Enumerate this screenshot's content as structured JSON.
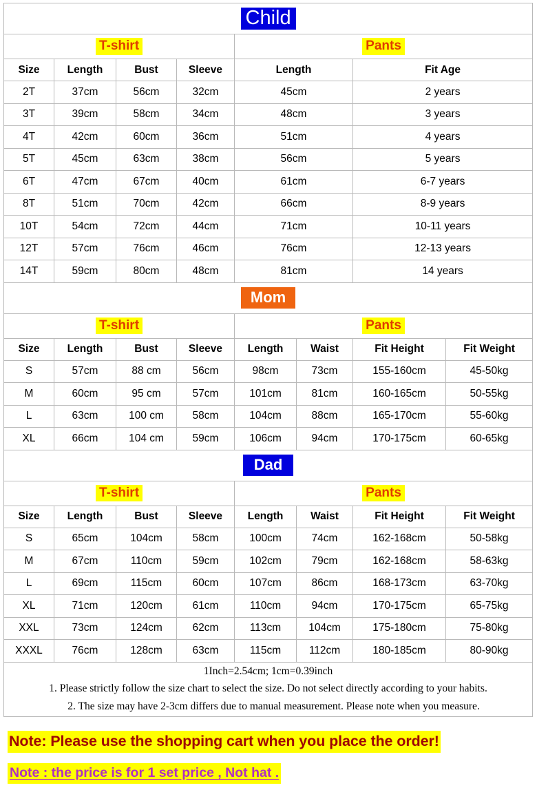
{
  "sections": [
    {
      "id": "child",
      "title": "Child",
      "title_bg": "#0000dd",
      "title_color": "#ffffff",
      "garments": {
        "tshirt": "T-shirt",
        "pants": "Pants"
      },
      "headers": [
        "Size",
        "Length",
        "Bust",
        "Sleeve",
        "Length",
        "Fit Age"
      ],
      "rows": [
        [
          "2T",
          "37cm",
          "56cm",
          "32cm",
          "45cm",
          "2 years"
        ],
        [
          "3T",
          "39cm",
          "58cm",
          "34cm",
          "48cm",
          "3 years"
        ],
        [
          "4T",
          "42cm",
          "60cm",
          "36cm",
          "51cm",
          "4 years"
        ],
        [
          "5T",
          "45cm",
          "63cm",
          "38cm",
          "56cm",
          "5 years"
        ],
        [
          "6T",
          "47cm",
          "67cm",
          "40cm",
          "61cm",
          "6-7 years"
        ],
        [
          "8T",
          "51cm",
          "70cm",
          "42cm",
          "66cm",
          "8-9 years"
        ],
        [
          "10T",
          "54cm",
          "72cm",
          "44cm",
          "71cm",
          "10-11 years"
        ],
        [
          "12T",
          "57cm",
          "76cm",
          "46cm",
          "76cm",
          "12-13 years"
        ],
        [
          "14T",
          "59cm",
          "80cm",
          "48cm",
          "81cm",
          "14 years"
        ]
      ]
    },
    {
      "id": "mom",
      "title": "Mom",
      "title_bg": "#ef6410",
      "title_color": "#ffffff",
      "garments": {
        "tshirt": "T-shirt",
        "pants": "Pants"
      },
      "headers": [
        "Size",
        "Length",
        "Bust",
        "Sleeve",
        "Length",
        "Waist",
        "Fit Height",
        "Fit Weight"
      ],
      "rows": [
        [
          "S",
          "57cm",
          "88 cm",
          "56cm",
          "98cm",
          "73cm",
          "155-160cm",
          "45-50kg"
        ],
        [
          "M",
          "60cm",
          "95 cm",
          "57cm",
          "101cm",
          "81cm",
          "160-165cm",
          "50-55kg"
        ],
        [
          "L",
          "63cm",
          "100 cm",
          "58cm",
          "104cm",
          "88cm",
          "165-170cm",
          "55-60kg"
        ],
        [
          "XL",
          "66cm",
          "104 cm",
          "59cm",
          "106cm",
          "94cm",
          "170-175cm",
          "60-65kg"
        ]
      ]
    },
    {
      "id": "dad",
      "title": "Dad",
      "title_bg": "#0000dd",
      "title_color": "#ffffff",
      "garments": {
        "tshirt": "T-shirt",
        "pants": "Pants"
      },
      "headers": [
        "Size",
        "Length",
        "Bust",
        "Sleeve",
        "Length",
        "Waist",
        "Fit Height",
        "Fit Weight"
      ],
      "rows": [
        [
          "S",
          "65cm",
          "104cm",
          "58cm",
          "100cm",
          "74cm",
          "162-168cm",
          "50-58kg"
        ],
        [
          "M",
          "67cm",
          "110cm",
          "59cm",
          "102cm",
          "79cm",
          "162-168cm",
          "58-63kg"
        ],
        [
          "L",
          "69cm",
          "115cm",
          "60cm",
          "107cm",
          "86cm",
          "168-173cm",
          "63-70kg"
        ],
        [
          "XL",
          "71cm",
          "120cm",
          "61cm",
          "110cm",
          "94cm",
          "170-175cm",
          "65-75kg"
        ],
        [
          "XXL",
          "73cm",
          "124cm",
          "62cm",
          "113cm",
          "104cm",
          "175-180cm",
          "75-80kg"
        ],
        [
          "XXXL",
          "76cm",
          "128cm",
          "63cm",
          "115cm",
          "112cm",
          "180-185cm",
          "80-90kg"
        ]
      ]
    }
  ],
  "notes": {
    "conversion": "1Inch=2.54cm; 1cm=0.39inch",
    "line1": "1. Please strictly follow the size chart to select the size. Do not select directly according to your habits.",
    "line2": "2. The size may have 2-3cm differs due to manual measurement. Please note when you measure."
  },
  "bottom_notes": {
    "warning1": "Note: Please use the shopping cart when you place the order!",
    "warning1_color": "#9e0505",
    "warning1_highlight": "#ffff00",
    "warning2": "Note : the price is for 1 set price , Not hat .",
    "warning2_color": "#b030c0",
    "warning2_highlight": "#ffff00"
  },
  "colors": {
    "garment_label_text": "#e03c00",
    "garment_label_bg": "#ffff00",
    "border": "#b9b9b9"
  }
}
